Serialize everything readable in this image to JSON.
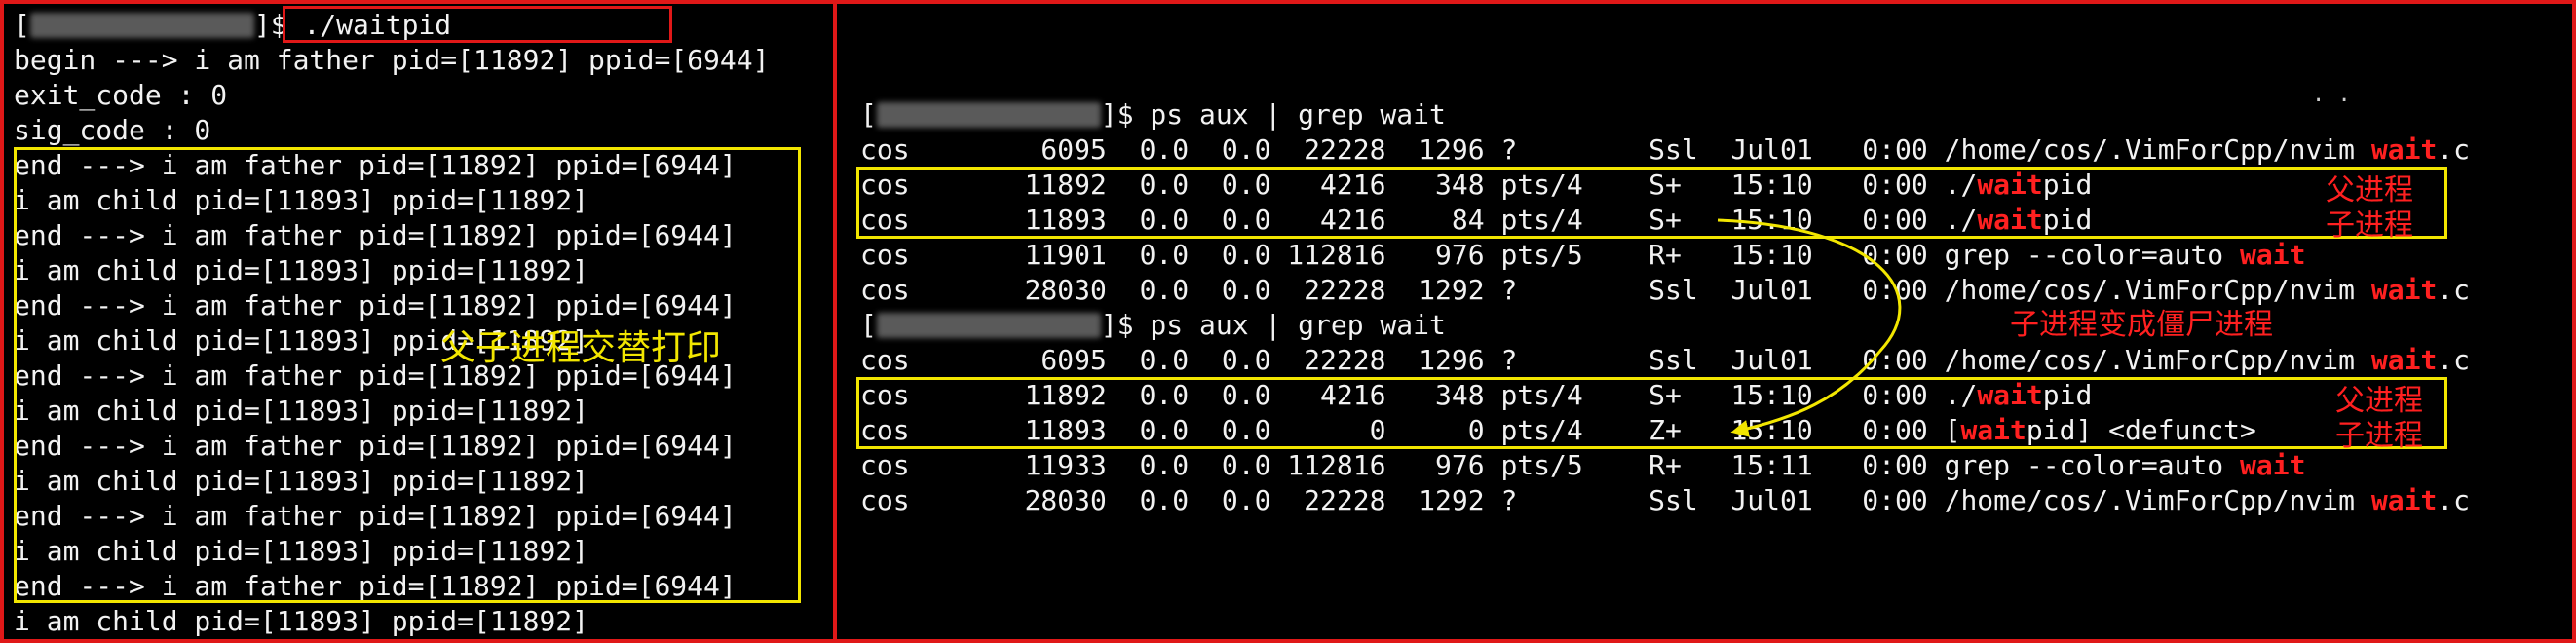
{
  "left_terminal": {
    "prompt_end": "]$ ",
    "command": "./waitpid",
    "lines": [
      "begin ---> i am father pid=[11892] ppid=[6944]",
      "exit_code : 0",
      "sig_code : 0",
      "end ---> i am father pid=[11892] ppid=[6944]",
      "i am child pid=[11893] ppid=[11892]",
      "end ---> i am father pid=[11892] ppid=[6944]",
      "i am child pid=[11893] ppid=[11892]",
      "end ---> i am father pid=[11892] ppid=[6944]",
      "i am child pid=[11893] ppid=[11892]",
      "end ---> i am father pid=[11892] ppid=[6944]",
      "i am child pid=[11893] ppid=[11892]",
      "end ---> i am father pid=[11892] ppid=[6944]",
      "i am child pid=[11893] ppid=[11892]",
      "end ---> i am father pid=[11892] ppid=[6944]",
      "i am child pid=[11893] ppid=[11892]",
      "end ---> i am father pid=[11892] ppid=[6944]",
      "i am child pid=[11893] ppid=[11892]"
    ],
    "annotation": "父子进程交替打印"
  },
  "right_terminal": {
    "dots": ". .",
    "ps_command": "]$ ps aux | grep wait",
    "rows_block1": [
      {
        "pre": "cos        6095  0.0  0.0  22228  1296 ?        Ssl  Jul01   0:00 /home/cos/.VimForCpp/nvim ",
        "hl": "wait",
        "post": ".c"
      },
      {
        "pre": "cos       11892  0.0  0.0   4216   348 pts/4    S+   15:10   0:00 ./",
        "hl": "wait",
        "post": "pid"
      },
      {
        "pre": "cos       11893  0.0  0.0   4216    84 pts/4    S+   15:10   0:00 ./",
        "hl": "wait",
        "post": "pid"
      },
      {
        "pre": "cos       11901  0.0  0.0 112816   976 pts/5    R+   15:10   0:00 grep --color=auto ",
        "hl": "wait",
        "post": ""
      },
      {
        "pre": "cos       28030  0.0  0.0  22228  1292 ?        Ssl  Jul01   0:00 /home/cos/.VimForCpp/nvim ",
        "hl": "wait",
        "post": ".c"
      }
    ],
    "rows_block2": [
      {
        "pre": "cos        6095  0.0  0.0  22228  1296 ?        Ssl  Jul01   0:00 /home/cos/.VimForCpp/nvim ",
        "hl": "wait",
        "post": ".c"
      },
      {
        "pre": "cos       11892  0.0  0.0   4216   348 pts/4    S+   15:10   0:00 ./",
        "hl": "wait",
        "post": "pid"
      },
      {
        "pre": "cos       11893  0.0  0.0      0     0 pts/4    Z+   15:10   0:00 [",
        "hl": "wait",
        "post": "pid] <defunct>"
      },
      {
        "pre": "cos       11933  0.0  0.0 112816   976 pts/5    R+   15:11   0:00 grep --color=auto ",
        "hl": "wait",
        "post": ""
      },
      {
        "pre": "cos       28030  0.0  0.0  22228  1292 ?        Ssl  Jul01   0:00 /home/cos/.VimForCpp/nvim ",
        "hl": "wait",
        "post": ".c"
      }
    ],
    "labels": {
      "parent": "父进程",
      "child": "子进程",
      "zombie": "子进程变成僵尸进程"
    }
  },
  "colors": {
    "frame": "#e01818",
    "highlight_box": "#f2e600",
    "match_text": "#ff2020",
    "annotation_red": "#ff2020",
    "annotation_yellow": "#f2e600",
    "text": "#f2f2f2",
    "background": "#000000"
  },
  "icons": {
    "arrow": "curved-arrow-icon"
  }
}
